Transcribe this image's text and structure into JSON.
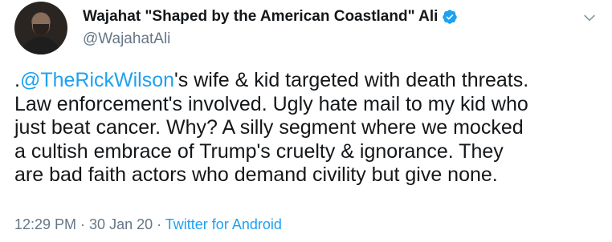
{
  "author": {
    "display_name": "Wajahat \"Shaped by the American Coastland\" Ali",
    "handle": "@WajahatAli",
    "verified": true
  },
  "tweet": {
    "prefix": ".",
    "mention": "@TheRickWilson",
    "line1_rest": "'s wife & kid targeted with death threats.",
    "line2": "Law enforcement's involved. Ugly hate mail to my kid who",
    "line3": "just beat cancer. Why? A silly segment where we mocked",
    "line4": "a cultish embrace of Trump's cruelty & ignorance. They",
    "line5": "are bad faith actors who demand civility but give none."
  },
  "meta": {
    "time": "12:29 PM",
    "separator": " · ",
    "date": "30 Jan 20",
    "source": "Twitter for Android"
  },
  "colors": {
    "link": "#1da1f2",
    "secondary_text": "#657786",
    "primary_text": "#14171a"
  },
  "icons": {
    "verified": "verified-badge-icon",
    "menu": "chevron-down-icon"
  }
}
